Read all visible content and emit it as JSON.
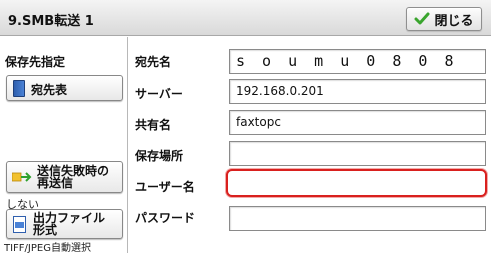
{
  "titlebar": {
    "title": "9.SMB転送 1",
    "close_label": "閉じる"
  },
  "left": {
    "section_label": "保存先指定",
    "address_book_label": "宛先表",
    "retry_label_line1": "送信失敗時の",
    "retry_label_line2": "再送信",
    "retry_value": "しない",
    "output_label_line1": "出力ファイル",
    "output_label_line2": "形式",
    "output_value": "TIFF/JPEG自動選択"
  },
  "form": {
    "fields": [
      {
        "label": "宛先名",
        "value": "s o u m u 0 8 0 8"
      },
      {
        "label": "サーバー",
        "value": "192.168.0.201"
      },
      {
        "label": "共有名",
        "value": "faxtopc"
      },
      {
        "label": "保存場所",
        "value": ""
      },
      {
        "label": "ユーザー名",
        "value": ""
      },
      {
        "label": "パスワード",
        "value": ""
      }
    ]
  },
  "colors": {
    "selection_border": "#d9201e",
    "icon_blue": "#2f5fae",
    "check_green": "#3aa52e"
  }
}
